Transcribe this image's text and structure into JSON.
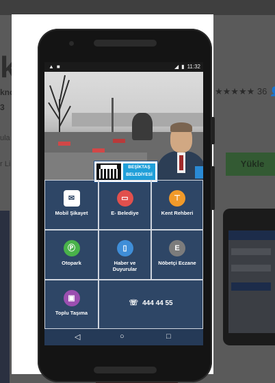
{
  "background": {
    "title_fragment": "kt",
    "dev_fragment": "kno",
    "num_fragment": "3",
    "side_text1": "ula",
    "side_text2": "r Li",
    "rating_text": "★★★★★ 36 👤",
    "install_label": "Yükle"
  },
  "status_bar": {
    "left_icons": [
      "warning-icon",
      "file-icon"
    ],
    "time": "11:32"
  },
  "logo": {
    "line1": "BEŞİKTAŞ",
    "line2": "BELEDİYESİ"
  },
  "tiles": [
    {
      "label": "Mobil Şikayet",
      "icon": "mail-icon",
      "color": "#ffffff"
    },
    {
      "label": "E- Belediye",
      "icon": "card-icon",
      "color": "#e1504d"
    },
    {
      "label": "Kent Rehberi",
      "icon": "signpost-icon",
      "color": "#f19a2a"
    },
    {
      "label": "Otopark",
      "icon": "parking-icon",
      "color": "#49b24a"
    },
    {
      "label": "Haber ve Duyurular",
      "icon": "phone-news-icon",
      "color": "#3f8ed8"
    },
    {
      "label": "Nöbetçi Eczane",
      "icon": "pharmacy-icon",
      "color": "#7c7c7c"
    },
    {
      "label": "Toplu Taşıma",
      "icon": "bus-icon",
      "color": "#9b4fb0"
    }
  ],
  "phone_number": "444 44 55",
  "navbar": {
    "back": "◁",
    "home": "○",
    "recent": "□"
  }
}
